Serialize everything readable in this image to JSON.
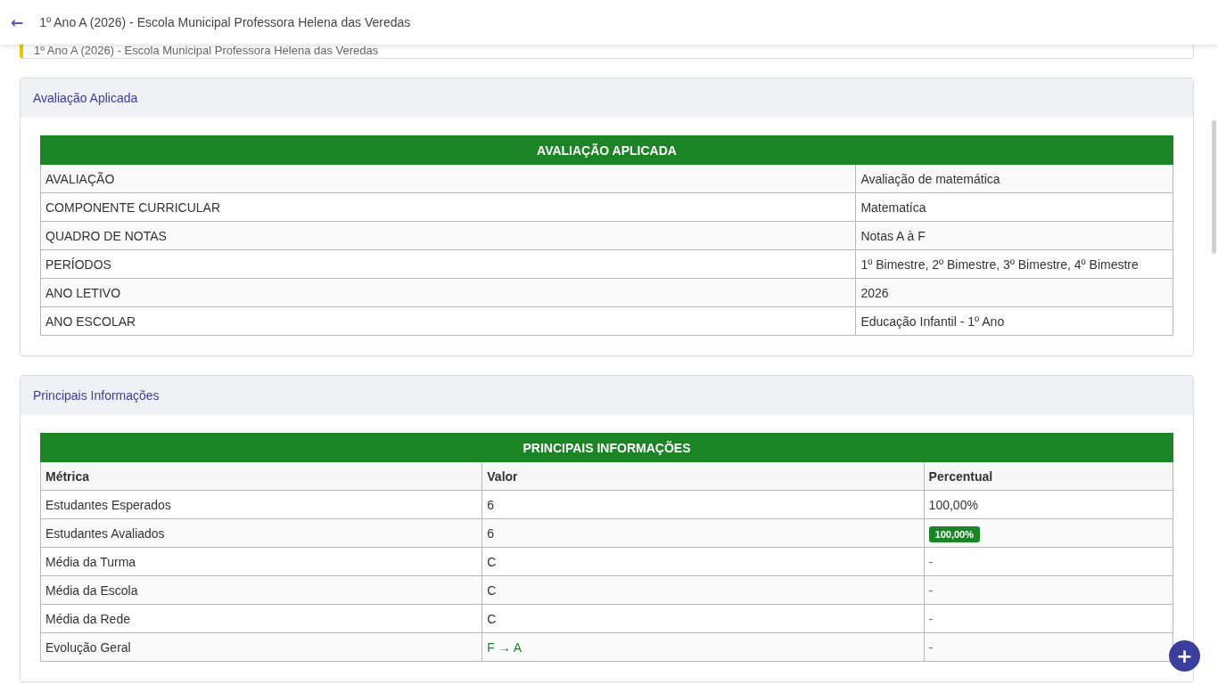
{
  "header": {
    "back": "←",
    "title": "1º Ano A (2026) - Escola Municipal Professora Helena das Veredas"
  },
  "context_card": {
    "text": "1º Ano A (2026) - Escola Municipal Professora Helena das Veredas"
  },
  "applied_assessment": {
    "card_title": "Avaliação Aplicada",
    "table_title": "AVALIAÇÃO APLICADA",
    "rows": [
      {
        "label": "AVALIAÇÃO",
        "value": "Avaliação de matemática"
      },
      {
        "label": "COMPONENTE CURRICULAR",
        "value": "Matematíca"
      },
      {
        "label": "QUADRO DE NOTAS",
        "value": "Notas A à F"
      },
      {
        "label": "PERÍODOS",
        "value": "1º Bimestre, 2º Bimestre, 3º Bimestre, 4º Bimestre"
      },
      {
        "label": "ANO LETIVO",
        "value": "2026"
      },
      {
        "label": "ANO ESCOLAR",
        "value": "Educação Infantil - 1º Ano"
      }
    ]
  },
  "main_info": {
    "card_title": "Principais Informações",
    "table_title": "PRINCIPAIS INFORMAÇÕES",
    "columns": [
      "Métrica",
      "Valor",
      "Percentual"
    ],
    "rows": [
      {
        "metric": "Estudantes Esperados",
        "value": {
          "text": "6",
          "kind": "plain"
        },
        "percent": {
          "text": "100,00%",
          "kind": "plain"
        }
      },
      {
        "metric": "Estudantes Avaliados",
        "value": {
          "text": "6",
          "kind": "plain"
        },
        "percent": {
          "text": "100,00%",
          "kind": "badge"
        }
      },
      {
        "metric": "Média da Turma",
        "value": {
          "text": "C",
          "kind": "plain"
        },
        "percent": {
          "text": "-",
          "kind": "muted"
        }
      },
      {
        "metric": "Média da Escola",
        "value": {
          "text": "C",
          "kind": "plain"
        },
        "percent": {
          "text": "-",
          "kind": "muted"
        }
      },
      {
        "metric": "Média da Rede",
        "value": {
          "text": "C",
          "kind": "plain"
        },
        "percent": {
          "text": "-",
          "kind": "muted"
        }
      },
      {
        "metric": "Evolução Geral",
        "value": {
          "text": "F → A",
          "kind": "highlight"
        },
        "percent": {
          "text": "-",
          "kind": "muted"
        }
      }
    ]
  },
  "fab": {
    "label": "+"
  }
}
